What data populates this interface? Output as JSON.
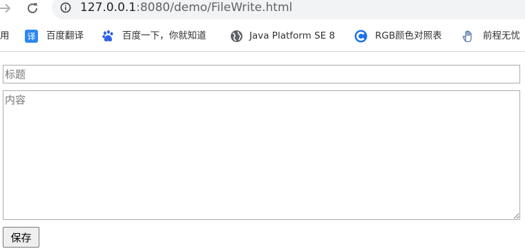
{
  "address_bar": {
    "url_host": "127.0.0.1",
    "url_rest": ":8080/demo/FileWrite.html"
  },
  "bookmarks": [
    {
      "label": "用",
      "icon": "apps-icon"
    },
    {
      "label": "百度翻译",
      "icon": "translate-icon",
      "icon_color": "#2b88f0"
    },
    {
      "label": "百度一下，你就知道",
      "icon": "baidu-paw-icon",
      "icon_color": "#2f62e6"
    },
    {
      "label": "Java Platform SE 8",
      "icon": "globe-icon"
    },
    {
      "label": "RGB颜色对照表",
      "icon": "c-logo-icon",
      "icon_color": "#1a73e8"
    },
    {
      "label": "前程无忧",
      "icon": "hand-icon"
    }
  ],
  "form": {
    "title_placeholder": "标题",
    "content_placeholder": "内容",
    "save_label": "保存"
  }
}
